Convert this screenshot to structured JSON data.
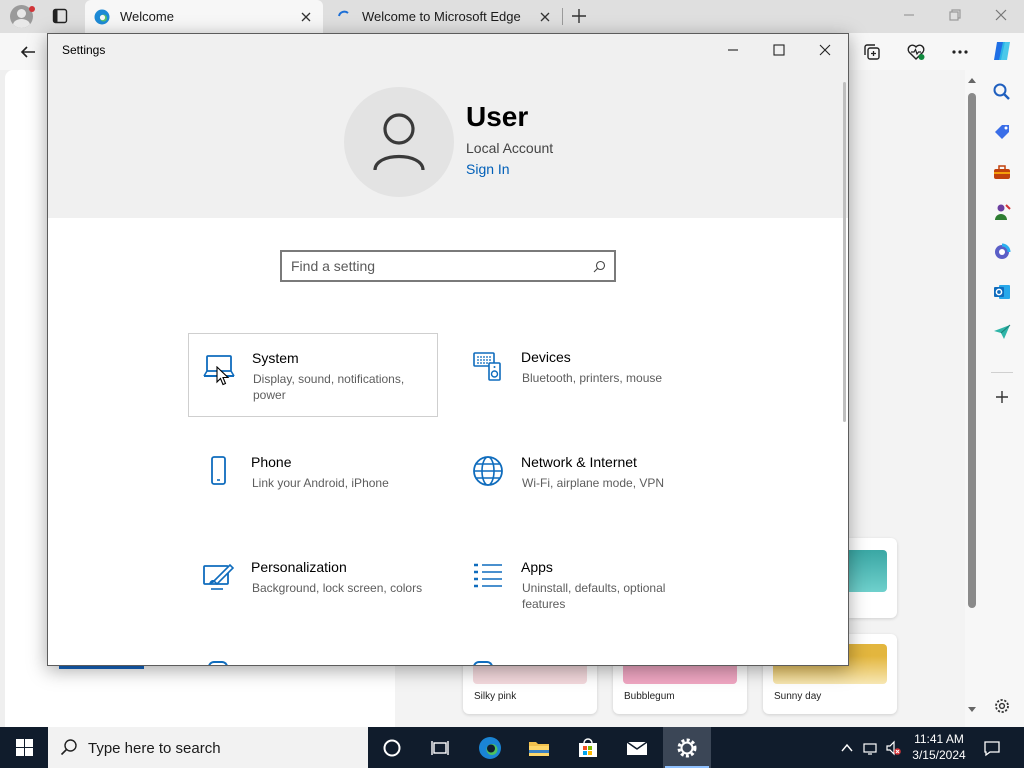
{
  "browser": {
    "tabs": [
      {
        "title": "Welcome",
        "active": true
      },
      {
        "title": "Welcome to Microsoft Edge",
        "active": false
      }
    ]
  },
  "newtab": {
    "themes": [
      {
        "name": "Silky pink",
        "color": "#f4d9dd"
      },
      {
        "name": "Bubblegum",
        "color": "#f1a7c3"
      },
      {
        "name": "Sunny day",
        "color": "#e9c24f"
      }
    ]
  },
  "settings": {
    "window_title": "Settings",
    "user": {
      "name": "User",
      "account_type": "Local Account",
      "sign_in": "Sign In"
    },
    "search": {
      "placeholder": "Find a setting"
    },
    "categories": [
      {
        "name": "System",
        "desc": "Display, sound, notifications, power",
        "icon": "laptop-icon"
      },
      {
        "name": "Devices",
        "desc": "Bluetooth, printers, mouse",
        "icon": "devices-icon"
      },
      {
        "name": "Phone",
        "desc": "Link your Android, iPhone",
        "icon": "phone-icon"
      },
      {
        "name": "Network & Internet",
        "desc": "Wi-Fi, airplane mode, VPN",
        "icon": "globe-icon"
      },
      {
        "name": "Personalization",
        "desc": "Background, lock screen, colors",
        "icon": "personalization-icon"
      },
      {
        "name": "Apps",
        "desc": "Uninstall, defaults, optional features",
        "icon": "apps-icon"
      }
    ]
  },
  "taskbar": {
    "search_placeholder": "Type here to search",
    "time": "11:41 AM",
    "date": "3/15/2024"
  },
  "colors": {
    "accent": "#0f6cbd",
    "link": "#005fb8",
    "taskbar": "#101c2c"
  }
}
